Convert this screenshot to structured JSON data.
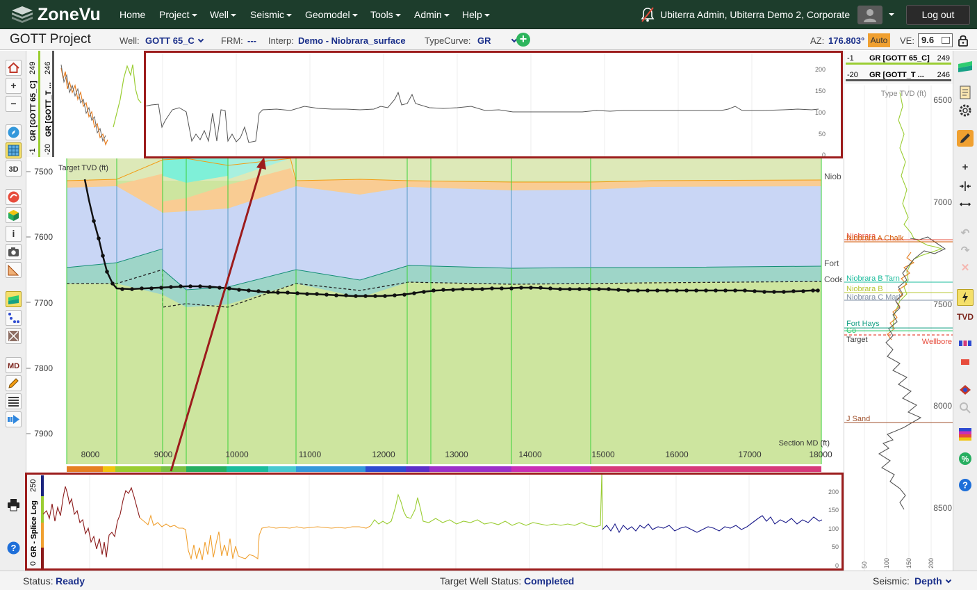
{
  "app": {
    "name": "ZoneVu"
  },
  "nav": {
    "home": "Home",
    "project": "Project",
    "well": "Well",
    "seismic": "Seismic",
    "geomodel": "Geomodel",
    "tools": "Tools",
    "admin": "Admin",
    "help": "Help",
    "user": "Ubiterra Admin, Ubiterra Demo 2, Corporate",
    "logout": "Log out"
  },
  "project_bar": {
    "title": "GOTT Project",
    "well_label": "Well:",
    "well_value": "GOTT 65_C",
    "frm_label": "FRM:",
    "frm_value": "---",
    "interp_label": "Interp:",
    "interp_value": "Demo - Niobrara_surface",
    "typecurve_label": "TypeCurve:",
    "typecurve_value": "GR",
    "az_label": "AZ:",
    "az_value": "176.803°",
    "auto": "Auto",
    "ve_label": "VE:",
    "ve_value": "9.6"
  },
  "top_strip": {
    "track1_top": "249",
    "track1_bottom": "-1",
    "track1_name": "GR [GOTT 65_C]",
    "track2_top": "246",
    "track2_bottom": "-20",
    "track2_name": "GR [GOTT_T ...",
    "scale_ticks": [
      "200",
      "150",
      "100",
      "50",
      "0"
    ]
  },
  "main_plot": {
    "y_axis_title": "Target TVD (ft)",
    "x_axis_title": "Section MD (ft)",
    "y_ticks": [
      "7500",
      "7600",
      "7700",
      "7800",
      "7900"
    ],
    "x_ticks": [
      "8000",
      "9000",
      "10000",
      "11000",
      "12000",
      "13000",
      "14000",
      "15000",
      "16000",
      "17000",
      "18000"
    ],
    "formation_labels": [
      "Niob",
      "Fort",
      "Code"
    ]
  },
  "bottom_log": {
    "title": "GR - Splice Log",
    "scale_top": "250",
    "scale_bottom": "0",
    "scale_ticks": [
      "200",
      "150",
      "100",
      "50",
      "0"
    ]
  },
  "right_log": {
    "header1_left": "-1",
    "header1_name": "GR [GOTT 65_C]",
    "header1_right": "249",
    "header2_left": "-20",
    "header2_name": "GR [GOTT_T ...",
    "header2_right": "246",
    "axis_title": "Type TVD (ft)",
    "depth_ticks": [
      "6500",
      "7000",
      "7500",
      "8000",
      "8500"
    ],
    "x_ticks": [
      "50",
      "100",
      "150",
      "200"
    ],
    "tops": [
      {
        "label": "Niobrara",
        "color": "#e74c3c"
      },
      {
        "label": "Niobrara A Chalk",
        "color": "#d35400"
      },
      {
        "label": "Niobrara B Tarn",
        "color": "#1abc9c"
      },
      {
        "label": "Niobrara B",
        "color": "#b7c733"
      },
      {
        "label": "Niobrara C Marl",
        "color": "#7f8fa6"
      },
      {
        "label": "Fort Hays",
        "color": "#16a085"
      },
      {
        "label": "Co",
        "color": "#2ecc71"
      },
      {
        "label": "Target",
        "color": "#333333"
      },
      {
        "label": "Wellbore",
        "color": "#e74c3c"
      },
      {
        "label": "J Sand",
        "color": "#a0522d"
      }
    ]
  },
  "status": {
    "status_label": "Status:",
    "status_value": "Ready",
    "target_label": "Target Well Status:",
    "target_value": "Completed",
    "seismic_label": "Seismic:",
    "seismic_value": "Depth"
  },
  "icons": {
    "left": [
      "home-icon",
      "zoom-in-icon",
      "zoom-out-icon",
      "compass-icon",
      "grid-icon",
      "3d-view-icon",
      "seismic-icon",
      "cube-icon",
      "info-icon",
      "camera-icon",
      "ruler-icon",
      "section-icon",
      "dots-icon",
      "crossplot-icon",
      "md-icon",
      "pencil-icon",
      "lines-icon",
      "forward-icon",
      "print-icon",
      "help-icon"
    ],
    "right": [
      "section-icon",
      "document-icon",
      "gear-icon",
      "pencil-icon",
      "plus-icon",
      "split-icon",
      "resize-icon",
      "undo-icon",
      "redo-icon",
      "close-icon",
      "tvd-icon",
      "tracks-icon",
      "stop-icon",
      "eye-icon",
      "search-icon",
      "palette-icon",
      "percent-icon",
      "help-icon"
    ]
  }
}
